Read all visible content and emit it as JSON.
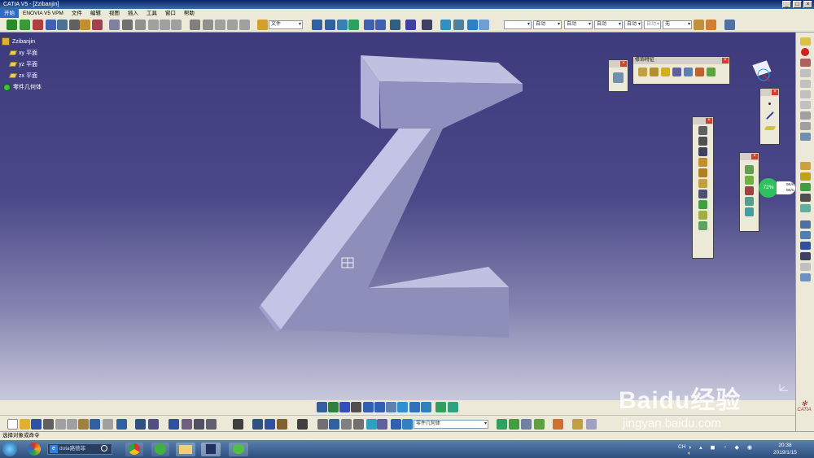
{
  "window": {
    "title": "CATIA V5 - [Zzibanjin]",
    "controls": [
      "_",
      "□",
      "×"
    ]
  },
  "menu": [
    "开始",
    "ENOVIA V5 VPM",
    "文件",
    "编辑",
    "视图",
    "插入",
    "工具",
    "窗口",
    "帮助"
  ],
  "toolbar": {
    "combo_file": "文件",
    "combo_color": "",
    "combo_auto1": "自动",
    "combo_auto2": "自动",
    "combo_auto3": "自动",
    "combo_auto4": "自动",
    "combo_grey": "自动",
    "combo_none": "无"
  },
  "tree": {
    "root": "Zzibanjin",
    "items": [
      "xy 平面",
      "yz 平面",
      "zx 平面",
      "零件几何体"
    ]
  },
  "panels": {
    "dress_up_title": "修饰特征"
  },
  "model_letter": "Z",
  "gauge": {
    "percent": "72%",
    "value_a": "0K/s",
    "value_b": "0K/s"
  },
  "bottom_combo": "零件几何体",
  "status_text": "选择对象或命令",
  "taskbar": {
    "search_text": "dota路德菲",
    "lang": "CH",
    "time": "20:38",
    "date": "2019/1/15"
  },
  "watermark": {
    "brand": "Baidu经验",
    "url": "jingyan.baidu.com"
  },
  "catia_logo": "CATIA",
  "colors": {
    "accent": "#316ac5",
    "bg_top": "#3d3b7c",
    "model": "#9b9bc8"
  }
}
